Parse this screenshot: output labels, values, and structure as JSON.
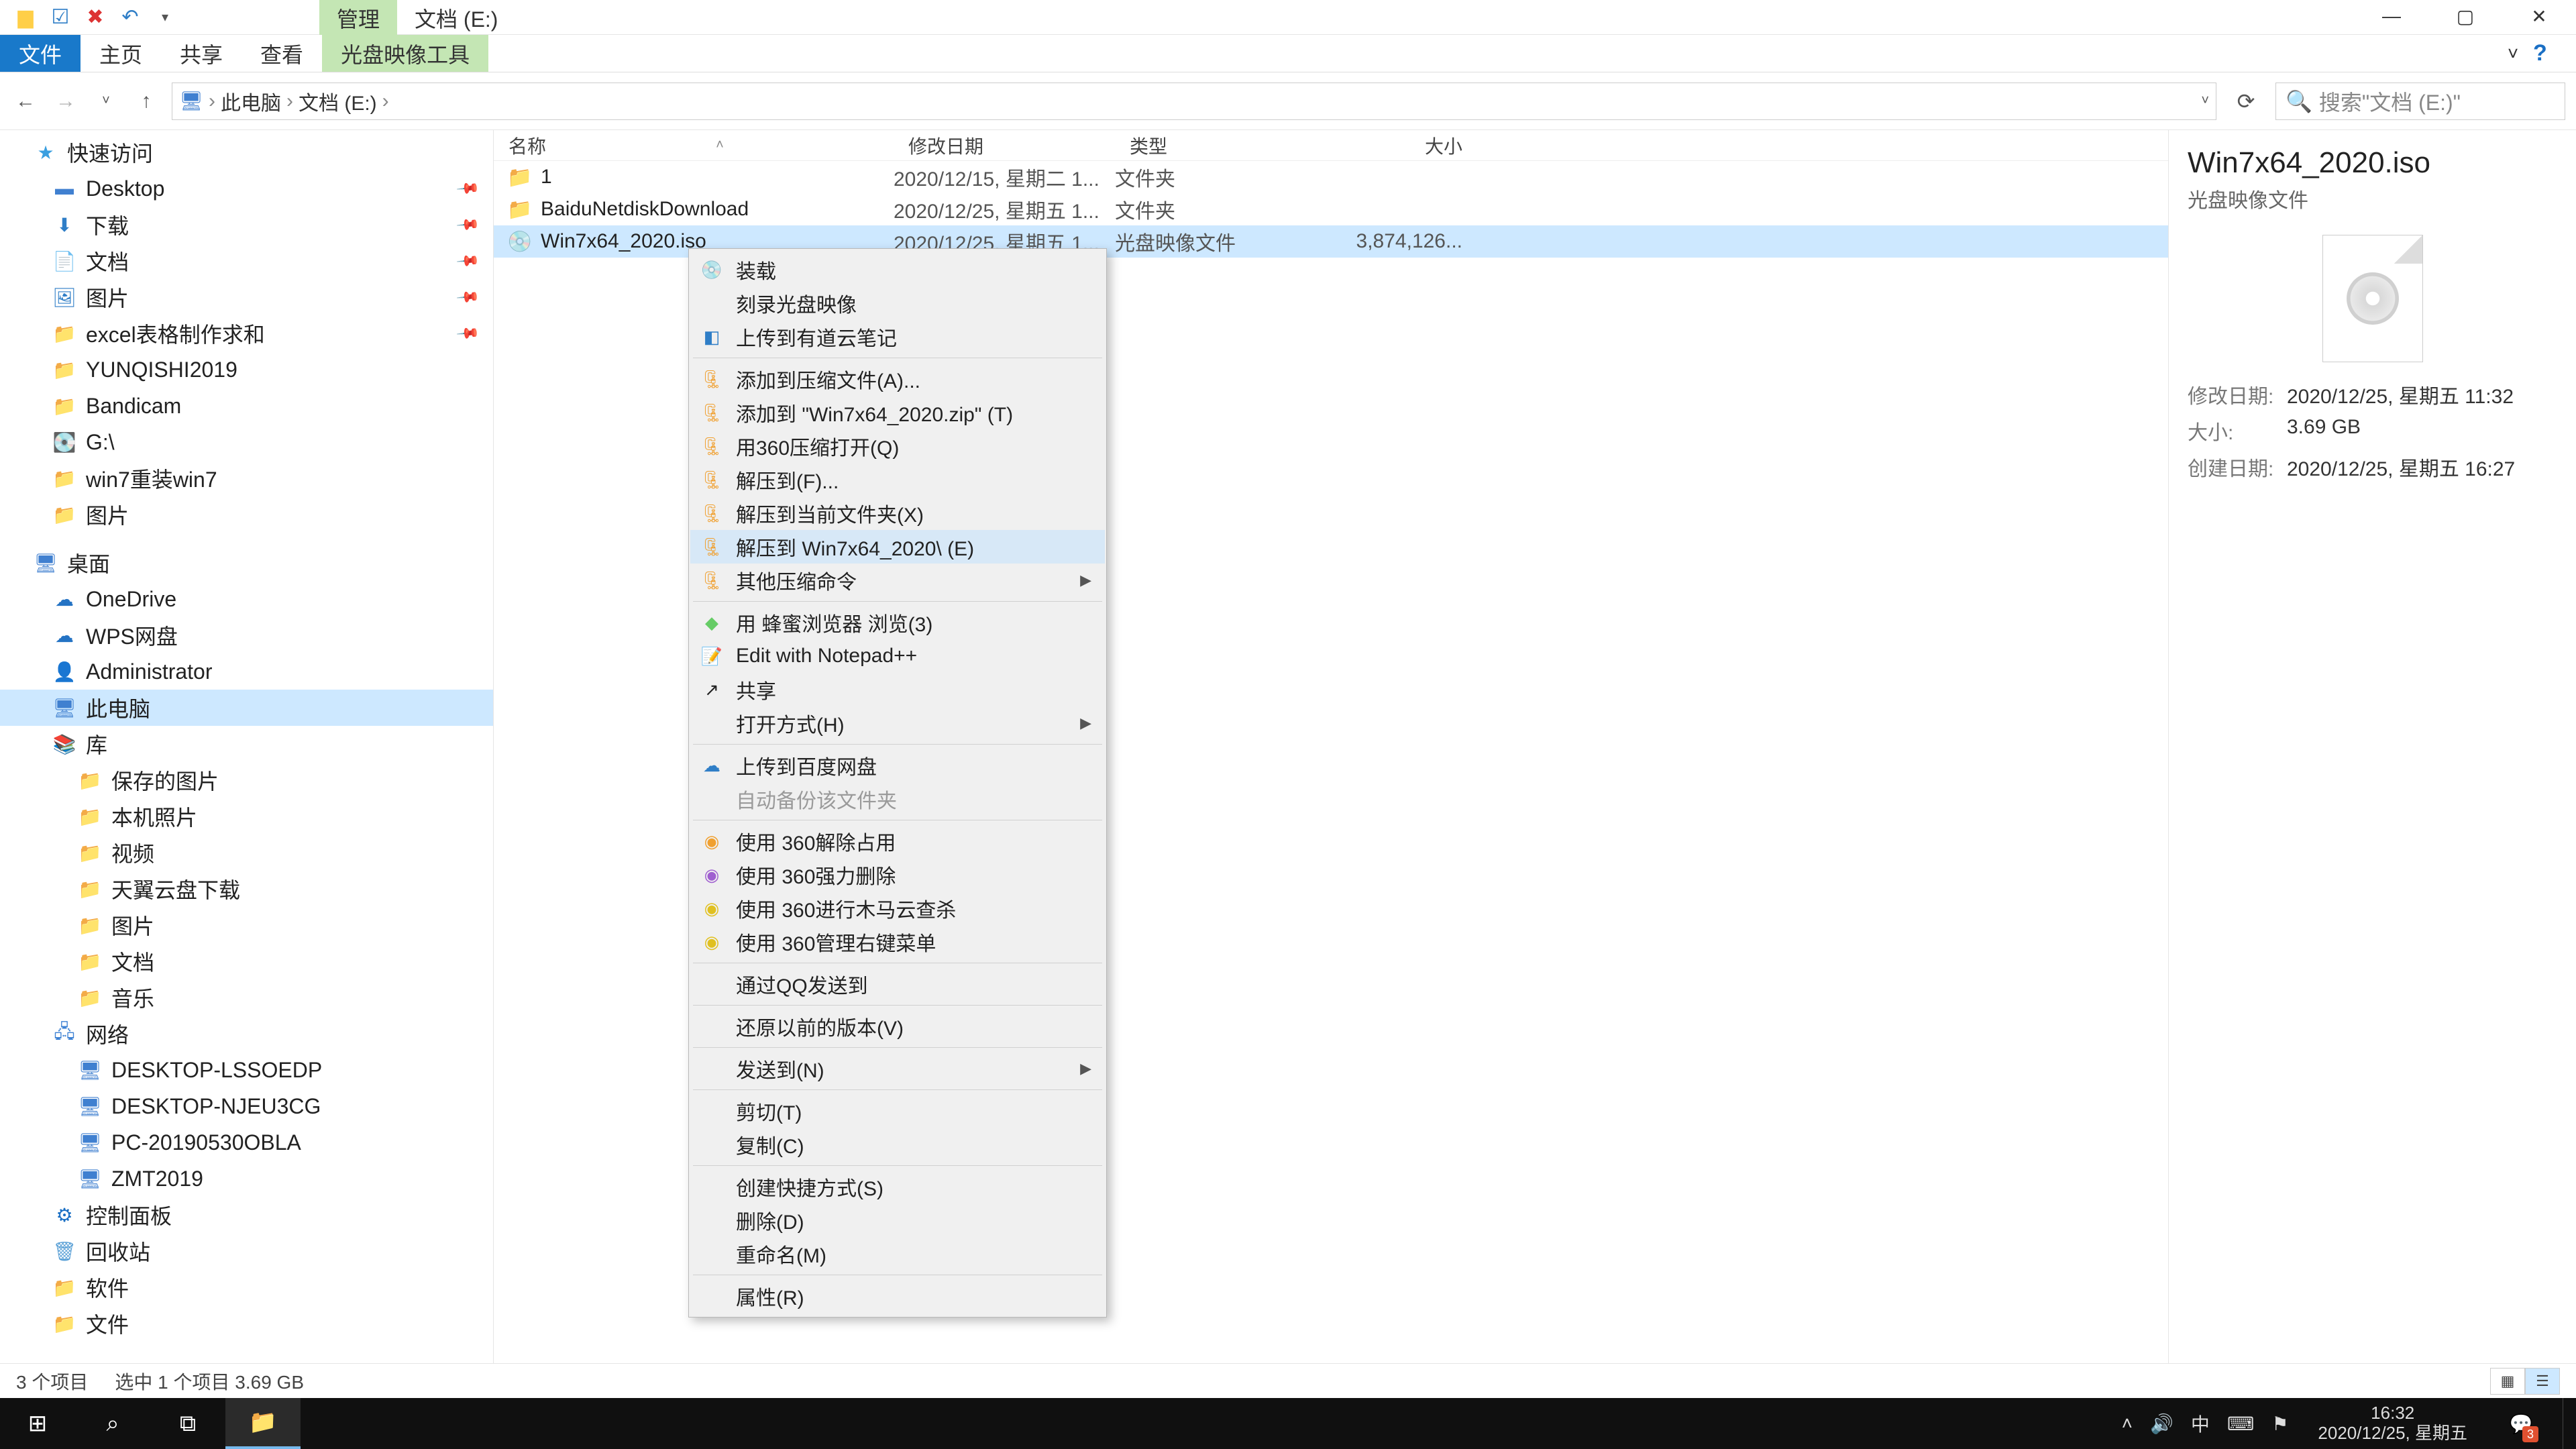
{
  "titlebar": {
    "context_tab": "管理",
    "title": "文档 (E:)"
  },
  "ribbon": {
    "tabs": [
      "文件",
      "主页",
      "共享",
      "查看",
      "光盘映像工具"
    ]
  },
  "nav": {
    "crumbs": [
      "此电脑",
      "文档 (E:)"
    ],
    "search_placeholder": "搜索\"文档 (E:)\""
  },
  "sidebar": {
    "quick_access": "快速访问",
    "items_qa": [
      "Desktop",
      "下载",
      "文档",
      "图片",
      "excel表格制作求和",
      "YUNQISHI2019",
      "Bandicam",
      "G:\\",
      "win7重装win7",
      "图片"
    ],
    "desktop": "桌面",
    "items_dt": [
      "OneDrive",
      "WPS网盘",
      "Administrator",
      "此电脑",
      "库"
    ],
    "lib_items": [
      "保存的图片",
      "本机照片",
      "视频",
      "天翼云盘下载",
      "图片",
      "文档",
      "音乐"
    ],
    "network": "网络",
    "net_items": [
      "DESKTOP-LSSOEDP",
      "DESKTOP-NJEU3CG",
      "PC-20190530OBLA",
      "ZMT2019"
    ],
    "ctrl_panel": "控制面板",
    "recycle": "回收站",
    "software": "软件",
    "files": "文件"
  },
  "columns": {
    "name": "名称",
    "date": "修改日期",
    "type": "类型",
    "size": "大小"
  },
  "rows": [
    {
      "name": "1",
      "date": "2020/12/15, 星期二 1...",
      "type": "文件夹",
      "size": ""
    },
    {
      "name": "BaiduNetdiskDownload",
      "date": "2020/12/25, 星期五 1...",
      "type": "文件夹",
      "size": ""
    },
    {
      "name": "Win7x64_2020.iso",
      "date": "2020/12/25, 星期五 1...",
      "type": "光盘映像文件",
      "size": "3,874,126..."
    }
  ],
  "context_menu": {
    "g1": [
      "装载",
      "刻录光盘映像",
      "上传到有道云笔记"
    ],
    "g2": [
      "添加到压缩文件(A)...",
      "添加到 \"Win7x64_2020.zip\" (T)",
      "用360压缩打开(Q)",
      "解压到(F)...",
      "解压到当前文件夹(X)",
      "解压到 Win7x64_2020\\ (E)",
      "其他压缩命令"
    ],
    "g3": [
      "用 蜂蜜浏览器 浏览(3)",
      "Edit with Notepad++",
      "共享",
      "打开方式(H)"
    ],
    "g4": [
      "上传到百度网盘",
      "自动备份该文件夹"
    ],
    "g5": [
      "使用 360解除占用",
      "使用 360强力删除",
      "使用 360进行木马云查杀",
      "使用 360管理右键菜单"
    ],
    "g6": [
      "通过QQ发送到"
    ],
    "g7": [
      "还原以前的版本(V)"
    ],
    "g8": [
      "发送到(N)"
    ],
    "g9": [
      "剪切(T)",
      "复制(C)"
    ],
    "g10": [
      "创建快捷方式(S)",
      "删除(D)",
      "重命名(M)"
    ],
    "g11": [
      "属性(R)"
    ]
  },
  "details": {
    "title": "Win7x64_2020.iso",
    "subtitle": "光盘映像文件",
    "mod_label": "修改日期:",
    "mod_val": "2020/12/25, 星期五 11:32",
    "size_label": "大小:",
    "size_val": "3.69 GB",
    "create_label": "创建日期:",
    "create_val": "2020/12/25, 星期五 16:27"
  },
  "status": {
    "items": "3 个项目",
    "sel": "选中 1 个项目  3.69 GB"
  },
  "taskbar": {
    "ime": "中",
    "time": "16:32",
    "date": "2020/12/25, 星期五",
    "badge": "3"
  }
}
